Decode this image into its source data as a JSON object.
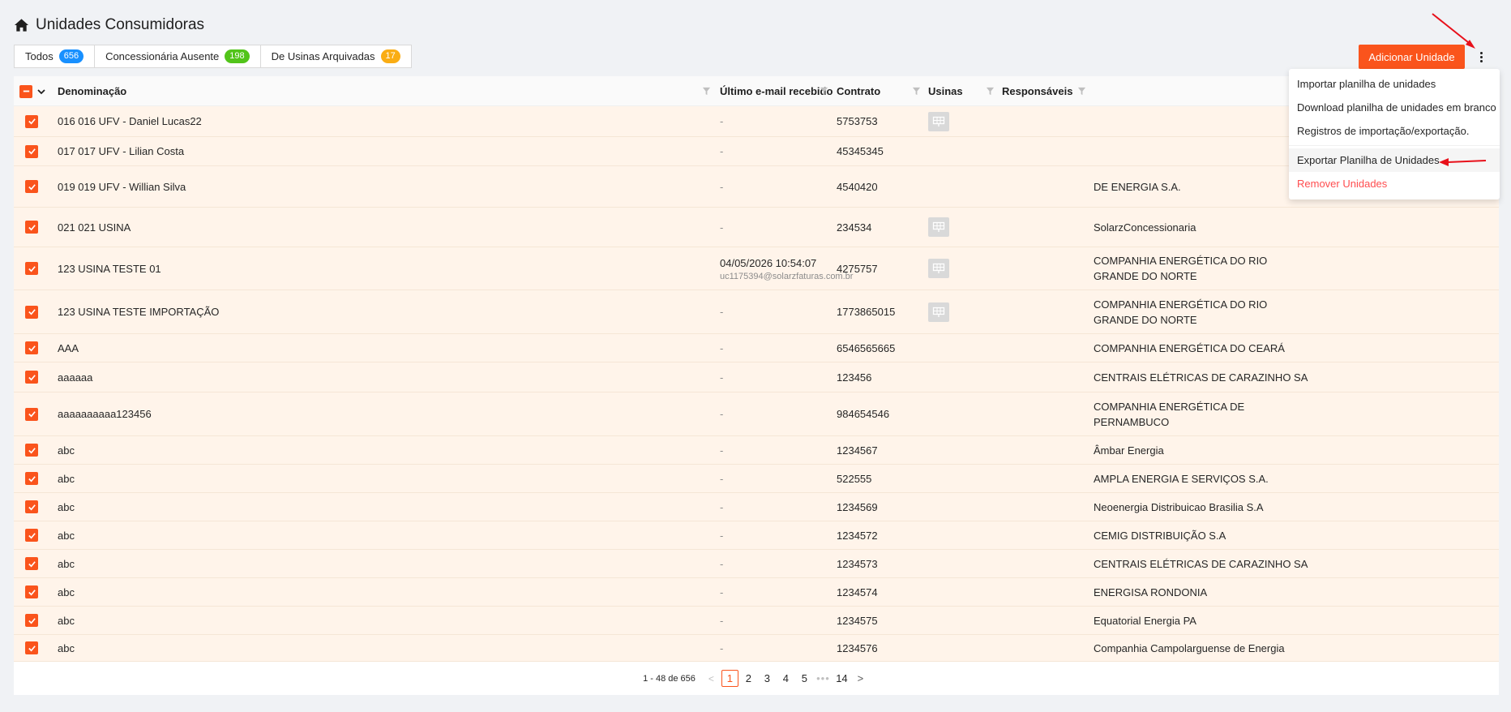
{
  "page": {
    "title": "Unidades Consumidoras",
    "title_icon": "home-icon"
  },
  "tabs": [
    {
      "label": "Todos",
      "count": "656",
      "color": "#1890ff"
    },
    {
      "label": "Concessionária Ausente",
      "count": "198",
      "color": "#52c41a"
    },
    {
      "label": "De Usinas Arquivadas",
      "count": "17",
      "color": "#faad14"
    }
  ],
  "toolbar": {
    "add_label": "Adicionar Unidade",
    "more_icon": "more-vertical-icon"
  },
  "accent_color": "#fa541c",
  "columns": {
    "denominacao": "Denominação",
    "email": "Último e-mail recebido",
    "contrato": "Contrato",
    "usinas": "Usinas",
    "responsaveis": "Responsáveis"
  },
  "rows": [
    {
      "name": "016 016 UFV - Daniel Lucas22",
      "email": "-",
      "email_sub": "",
      "contract": "5753753",
      "usina": true,
      "conc1": "",
      "conc2": ""
    },
    {
      "name": "017 017 UFV - Lilian Costa",
      "email": "-",
      "email_sub": "",
      "contract": "45345345",
      "usina": false,
      "conc1": "",
      "conc2": ""
    },
    {
      "name": "019 019 UFV - Willian Silva",
      "email": "-",
      "email_sub": "",
      "contract": "4540420",
      "usina": false,
      "conc1": "",
      "conc2": "DE ENERGIA S.A."
    },
    {
      "name": "021 021 USINA",
      "email": "-",
      "email_sub": "",
      "contract": "234534",
      "usina": true,
      "conc1": "SolarzConcessionaria",
      "conc2": ""
    },
    {
      "name": "123 USINA TESTE 01",
      "email": "04/05/2026 10:54:07",
      "email_sub": "uc1175394@solarzfaturas.com.br",
      "contract": "4275757",
      "usina": true,
      "conc1": "COMPANHIA ENERGÉTICA DO RIO",
      "conc2": "GRANDE DO NORTE"
    },
    {
      "name": "123 USINA TESTE IMPORTAÇÃO",
      "email": "-",
      "email_sub": "",
      "contract": "1773865015",
      "usina": true,
      "conc1": "COMPANHIA ENERGÉTICA DO RIO",
      "conc2": "GRANDE DO NORTE"
    },
    {
      "name": "AAA",
      "email": "-",
      "email_sub": "",
      "contract": "6546565665",
      "usina": false,
      "conc1": "COMPANHIA ENERGÉTICA DO CEARÁ",
      "conc2": ""
    },
    {
      "name": "aaaaaa",
      "email": "-",
      "email_sub": "",
      "contract": "123456",
      "usina": false,
      "conc1": "CENTRAIS ELÉTRICAS DE CARAZINHO SA",
      "conc2": ""
    },
    {
      "name": "aaaaaaaaaa123456",
      "email": "-",
      "email_sub": "",
      "contract": "984654546",
      "usina": false,
      "conc1": "COMPANHIA ENERGÉTICA DE",
      "conc2": "PERNAMBUCO"
    },
    {
      "name": "abc",
      "email": "-",
      "email_sub": "",
      "contract": "1234567",
      "usina": false,
      "conc1": "Âmbar Energia",
      "conc2": ""
    },
    {
      "name": "abc",
      "email": "-",
      "email_sub": "",
      "contract": "522555",
      "usina": false,
      "conc1": "AMPLA ENERGIA E SERVIÇOS S.A.",
      "conc2": ""
    },
    {
      "name": "abc",
      "email": "-",
      "email_sub": "",
      "contract": "1234569",
      "usina": false,
      "conc1": "Neoenergia Distribuicao Brasilia S.A",
      "conc2": ""
    },
    {
      "name": "abc",
      "email": "-",
      "email_sub": "",
      "contract": "1234572",
      "usina": false,
      "conc1": "CEMIG DISTRIBUIÇÃO S.A",
      "conc2": ""
    },
    {
      "name": "abc",
      "email": "-",
      "email_sub": "",
      "contract": "1234573",
      "usina": false,
      "conc1": "CENTRAIS ELÉTRICAS DE CARAZINHO SA",
      "conc2": ""
    },
    {
      "name": "abc",
      "email": "-",
      "email_sub": "",
      "contract": "1234574",
      "usina": false,
      "conc1": "ENERGISA RONDONIA",
      "conc2": ""
    },
    {
      "name": "abc",
      "email": "-",
      "email_sub": "",
      "contract": "1234575",
      "usina": false,
      "conc1": "Equatorial Energia PA",
      "conc2": ""
    },
    {
      "name": "abc",
      "email": "-",
      "email_sub": "",
      "contract": "1234576",
      "usina": false,
      "conc1": "Companhia Campolarguense de Energia",
      "conc2": ""
    }
  ],
  "pagination": {
    "total_text": "1 - 48 de 656",
    "pages": [
      "1",
      "2",
      "3",
      "4",
      "5"
    ],
    "active": "1",
    "ellipsis": "•••",
    "last": "14",
    "prev": "<",
    "next": ">"
  },
  "menu": {
    "items": [
      {
        "label": "Importar planilha de unidades"
      },
      {
        "label": "Download planilha de unidades em branco"
      },
      {
        "label": "Registros de importação/exportação."
      },
      {
        "label": "Exportar Planilha de Unidades"
      },
      {
        "label": "Remover Unidades"
      }
    ]
  }
}
